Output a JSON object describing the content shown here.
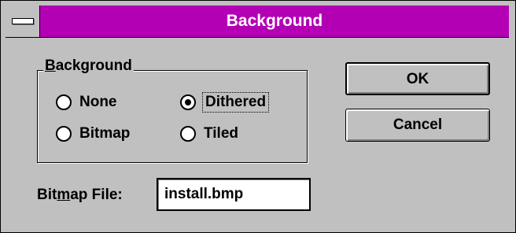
{
  "window": {
    "title": "Background"
  },
  "group": {
    "label_accel": "B",
    "label_rest": "ackground",
    "options": [
      {
        "label": "None",
        "selected": false
      },
      {
        "label": "Dithered",
        "selected": true
      },
      {
        "label": "Bitmap",
        "selected": false
      },
      {
        "label": "Tiled",
        "selected": false
      }
    ]
  },
  "buttons": {
    "ok": "OK",
    "cancel": "Cancel"
  },
  "bitmap_file": {
    "label_pre": "Bit",
    "label_accel": "m",
    "label_post": "ap File:",
    "value": "install.bmp"
  }
}
